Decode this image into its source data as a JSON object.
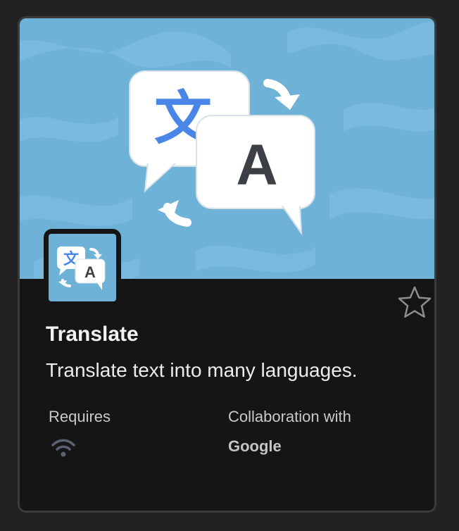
{
  "app": {
    "name": "Translate",
    "description": "Translate text into many languages.",
    "icon": "translate-icon",
    "hero_glyphs": {
      "source": "文",
      "target": "A"
    }
  },
  "details": {
    "requires_label": "Requires",
    "requires_icon": "wifi-icon",
    "collaboration_label": "Collaboration with",
    "collaboration_value": "Google"
  },
  "favorite": {
    "icon": "star-outline-icon",
    "active": false
  },
  "colors": {
    "hero_background": "#6fb2d8",
    "card_background": "#151515",
    "source_glyph": "#4a86e8",
    "target_glyph": "#3c4045"
  }
}
